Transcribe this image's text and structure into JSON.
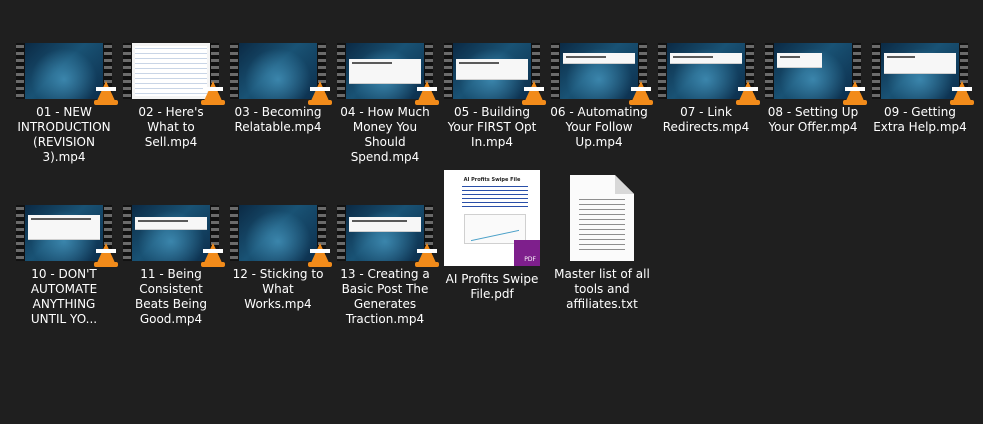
{
  "files": [
    {
      "label": "01 - NEW INTRODUCTION (REVISION 3).mp4",
      "type": "video",
      "frame_style": "blue",
      "icon": "vlc-cone-icon"
    },
    {
      "label": "02 - Here's What to Sell.mp4",
      "type": "video",
      "frame_style": "document",
      "icon": "vlc-cone-icon"
    },
    {
      "label": "03 - Becoming Relatable.mp4",
      "type": "video",
      "frame_style": "blue",
      "icon": "vlc-cone-icon"
    },
    {
      "label": "04 - How Much Money You Should Spend.mp4",
      "type": "video",
      "frame_style": "blue-overlay",
      "icon": "vlc-cone-icon"
    },
    {
      "label": "05 - Building Your FIRST Opt In.mp4",
      "type": "video",
      "frame_style": "blue-overlay",
      "icon": "vlc-cone-icon"
    },
    {
      "label": "06 - Automating Your Follow Up.mp4",
      "type": "video",
      "frame_style": "blue-overlay",
      "icon": "vlc-cone-icon"
    },
    {
      "label": "07 - Link Redirects.mp4",
      "type": "video",
      "frame_style": "blue-overlay",
      "icon": "vlc-cone-icon"
    },
    {
      "label": "08 - Setting Up Your Offer.mp4",
      "type": "video",
      "frame_style": "blue-overlay",
      "icon": "vlc-cone-icon"
    },
    {
      "label": "09 - Getting Extra Help.mp4",
      "type": "video",
      "frame_style": "blue-overlay",
      "icon": "vlc-cone-icon"
    },
    {
      "label": "10 - DON'T AUTOMATE ANYTHING UNTIL YO...",
      "type": "video",
      "frame_style": "blue-overlay",
      "icon": "vlc-cone-icon"
    },
    {
      "label": "11 - Being Consistent Beats Being Good.mp4",
      "type": "video",
      "frame_style": "blue-overlay",
      "icon": "vlc-cone-icon"
    },
    {
      "label": "12 - Sticking to What Works.mp4",
      "type": "video",
      "frame_style": "blue",
      "icon": "vlc-cone-icon"
    },
    {
      "label": "13 - Creating a Basic Post The Generates Traction.mp4",
      "type": "video",
      "frame_style": "blue-overlay",
      "icon": "vlc-cone-icon"
    },
    {
      "label": "AI Profits Swipe File.pdf",
      "type": "pdf",
      "icon": "pdf-badge-icon",
      "badge_text": "PDF",
      "preview_title": "AI Profits Swipe File"
    },
    {
      "label": "Master list of all tools and affiliates.txt",
      "type": "text",
      "icon": "text-document-icon"
    }
  ],
  "colors": {
    "background": "#1f1f1f",
    "label_text": "#ffffff",
    "vlc_orange": "#f28b1a",
    "pdf_badge": "#7e1f8c"
  }
}
